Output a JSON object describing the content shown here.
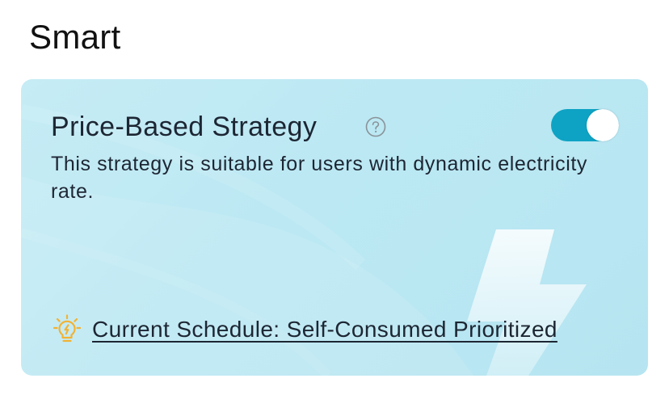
{
  "section": {
    "title": "Smart"
  },
  "strategy_card": {
    "title": "Price-Based Strategy",
    "help_icon": "question-circle-icon",
    "toggle_on": true,
    "description": "This strategy is suitable for users with dynamic electricity rate.",
    "schedule_icon": "lightbulb-icon",
    "schedule_link": "Current Schedule: Self-Consumed Prioritized"
  },
  "colors": {
    "card_background": "#bbe8f3",
    "toggle_on": "#0ea3c4",
    "bulb_accent": "#f2b233",
    "text": "#1d2633"
  }
}
